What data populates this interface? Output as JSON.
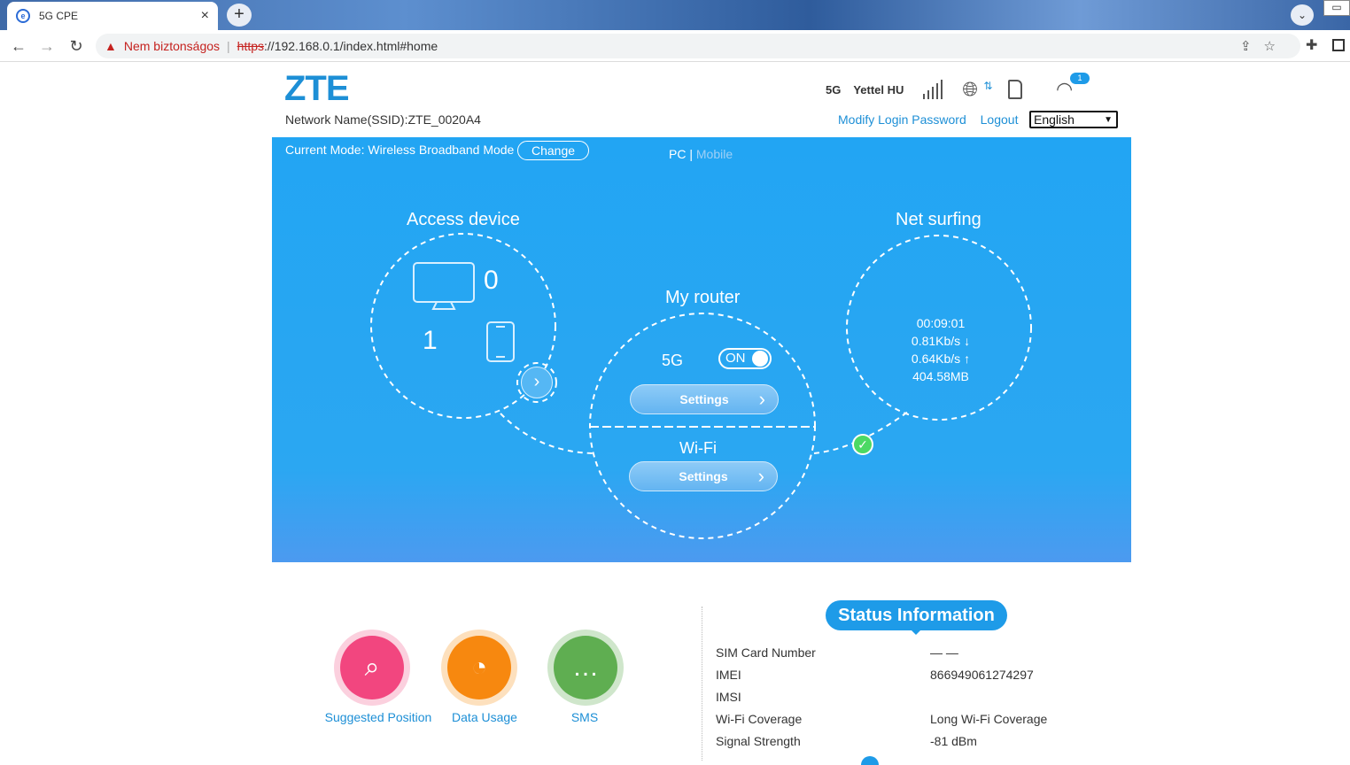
{
  "browser": {
    "tab_title": "5G CPE",
    "tab_close": "×",
    "new_tab": "+",
    "security_label": "Nem biztonságos",
    "url_scheme": "https",
    "url_rest": "://192.168.0.1/index.html#home"
  },
  "header": {
    "logo": "ZTE",
    "ssid_label": "Network Name(SSID):ZTE_0020A4",
    "network_type": "5G",
    "operator": "Yettel HU",
    "wifi_badge": "1",
    "modify_password": "Modify Login Password",
    "logout": "Logout",
    "language_selected": "English"
  },
  "hero": {
    "mode_text": "Current Mode: Wireless Broadband Mode",
    "change_button": "Change",
    "view_pc": "PC",
    "view_sep": " | ",
    "view_mobile": "Mobile",
    "access_device_title": "Access device",
    "pc_count": "0",
    "mobile_count": "1",
    "my_router_title": "My router",
    "band_label": "5G",
    "toggle_label": "ON",
    "settings_5g": "Settings",
    "wifi_title": "Wi-Fi",
    "settings_wifi": "Settings",
    "net_surfing_title": "Net surfing",
    "connected_time": "00:09:01",
    "download_speed": "0.81Kb/s ↓",
    "upload_speed": "0.64Kb/s ↑",
    "data_total": "404.58MB"
  },
  "quick_links": {
    "suggested_position": "Suggested Position",
    "data_usage": "Data Usage",
    "sms": "SMS"
  },
  "status": {
    "title": "Status Information",
    "rows": [
      {
        "label": "SIM Card Number",
        "value": "— —"
      },
      {
        "label": "IMEI",
        "value": "866949061274297"
      },
      {
        "label": "IMSI",
        "value": ""
      },
      {
        "label": "Wi-Fi Coverage",
        "value": "Long Wi-Fi Coverage"
      },
      {
        "label": "Signal Strength",
        "value": "-81 dBm"
      }
    ]
  },
  "colors": {
    "brand": "#1d8fd6",
    "hero_bg": "#22a5f3",
    "data_usage": "#f7880f",
    "suggested": "#f2467f",
    "sms": "#5fae51"
  }
}
